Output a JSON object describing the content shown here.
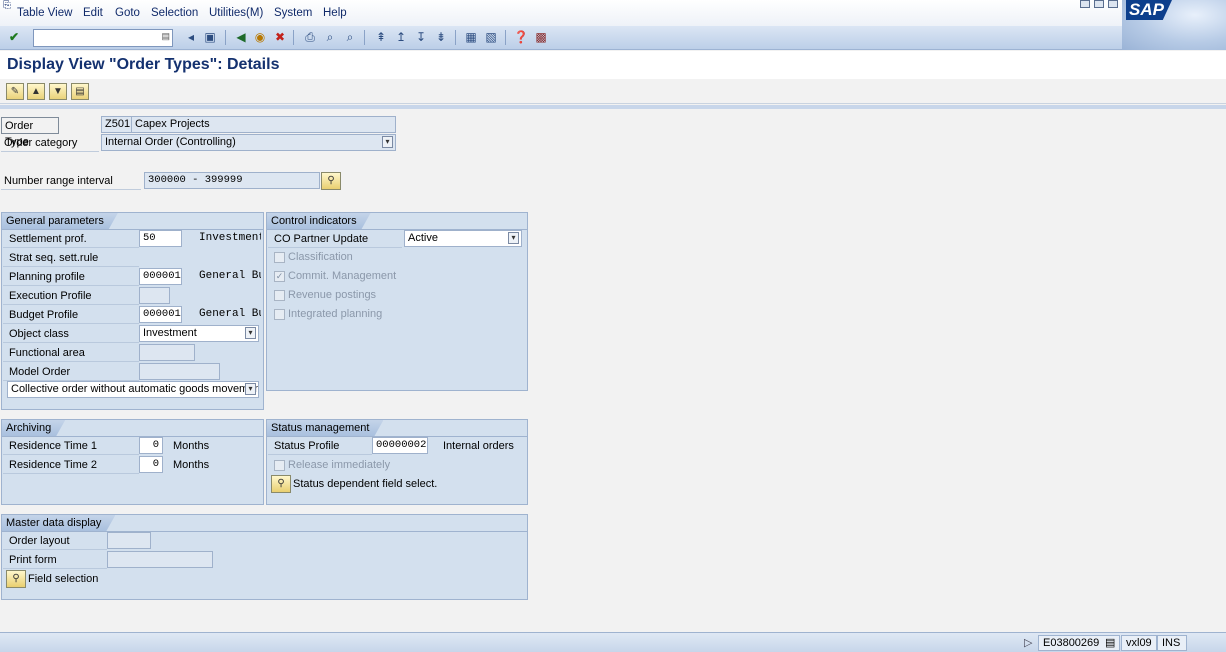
{
  "menu": [
    "Table View",
    "Edit",
    "Goto",
    "Selection",
    "Utilities(M)",
    "System",
    "Help"
  ],
  "brand": "SAP",
  "command_field": {
    "value": ""
  },
  "page_title": "Display View \"Order Types\": Details",
  "header": {
    "order_type_label": "Order Type",
    "order_type_code": "Z501",
    "order_type_desc": "Capex Projects",
    "order_category_label": "Order category",
    "order_category_value": "Internal Order (Controlling)",
    "number_range_label": "Number range interval",
    "number_range_value": "300000 - 399999"
  },
  "general_parameters": {
    "title": "General parameters",
    "settlement_prof_label": "Settlement prof.",
    "settlement_prof_value": "50",
    "settlement_prof_desc": "Investment",
    "strat_seq_label": "Strat seq. sett.rule",
    "planning_profile_label": "Planning profile",
    "planning_profile_value": "000001",
    "planning_profile_desc": "General Bu",
    "execution_profile_label": "Execution Profile",
    "budget_profile_label": "Budget Profile",
    "budget_profile_value": "000001",
    "budget_profile_desc": "General Bu",
    "object_class_label": "Object class",
    "object_class_value": "Investment",
    "functional_area_label": "Functional area",
    "model_order_label": "Model Order",
    "collective_order_value": "Collective order without automatic goods movement"
  },
  "control_indicators": {
    "title": "Control indicators",
    "co_partner_label": "CO Partner Update",
    "co_partner_value": "Active",
    "classification": "Classification",
    "commit_management": "Commit. Management",
    "revenue_postings": "Revenue postings",
    "integrated_planning": "Integrated planning"
  },
  "archiving": {
    "title": "Archiving",
    "residence1_label": "Residence Time 1",
    "residence1_value": "0",
    "residence2_label": "Residence Time 2",
    "residence2_value": "0",
    "unit": "Months"
  },
  "status_management": {
    "title": "Status management",
    "status_profile_label": "Status Profile",
    "status_profile_value": "00000002",
    "status_profile_desc": "Internal orders",
    "release_immediately": "Release immediately",
    "status_dependent_label": "Status dependent field select."
  },
  "master_data": {
    "title": "Master data display",
    "order_layout_label": "Order layout",
    "print_form_label": "Print form",
    "field_selection_label": "Field selection"
  },
  "status_bar": {
    "system": "E03800269",
    "client": "vxl09",
    "mode": "INS"
  }
}
